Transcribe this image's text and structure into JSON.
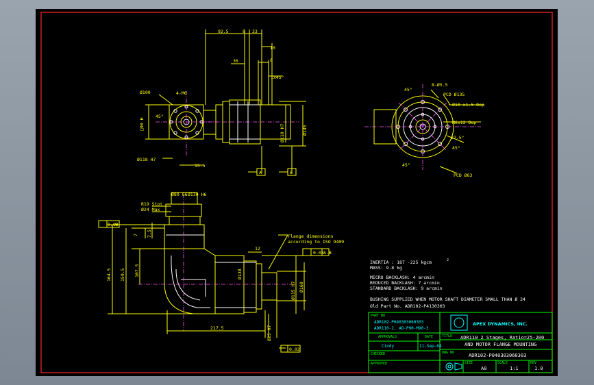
{
  "top_dims": {
    "d925": "92.5",
    "d8": "8",
    "d23": "23",
    "d10": "10",
    "d36": "36",
    "d6": "6",
    "d1x45": "1x45°",
    "d4m6": "4-M6",
    "d100": "Ø100",
    "d45": "45°",
    "d90": "□90 H",
    "d118": "Ø118 H7",
    "d155": "15.5",
    "dia110": "Ø110 H7",
    "d145": "Ø145",
    "A": "A",
    "B": "B"
  },
  "right_view": {
    "d55": "8-Ø5.5",
    "pcd135": "PCD Ø135",
    "m10": "Ø10 x1.5 Dep",
    "m6": "M6x12 Dep",
    "d45a": "45°",
    "d45b": "45°",
    "d225": "22.5°",
    "pcd63": "PCD Ø63",
    "d45c": "45°"
  },
  "side_dims": {
    "d80": "Ø80 G6",
    "d130": "Ø130 H6",
    "rt": "R19 Stot",
    "d24": "Ø24 Max",
    "tol1": "0.03",
    "tolA": "A",
    "d7": "7",
    "d75": "7.5",
    "d1645": "164.5",
    "d1595": "159.5",
    "d1075": "107.5",
    "d2175": "217.5",
    "d138": "Ø138",
    "d12": "12",
    "dia25": "Ø25 H7",
    "dia115": "Ø115 H7",
    "d160": "Ø160",
    "tol2": "0.03",
    "tolAB": "A-B",
    "tol3": "0.02",
    "flange": "Flange dimensions",
    "iso": "according to ISO 9409"
  },
  "notes": {
    "inertia": "INERTIA : 187 -225 kgcm",
    "sup": "2",
    "mass": "MASS: 9.8 kg",
    "micro": "MICRO BACKLASH: 4 arcmin",
    "reduced": "REDUCED BACKLASH: 7 arcmin",
    "standard": "STANDARD BACKLASH: 9 arcmin",
    "bushing": "BUSHING SUPPLIED WHEN MOTOR SHAFT DIAMETER SMALL THAN Ø 24",
    "old": "Old Part No. ADR102-P4130303"
  },
  "title_block": {
    "part_no_label": "PART NO",
    "part1": "ADR102-P040303060303",
    "part2": "ADR110-2, AD-P90-M90-3",
    "drawn_label": "APPROVALS",
    "date_label": "DATE",
    "drawn": "Cindy",
    "date": "11-Sep-08",
    "checked_label": "CHECKED",
    "approved_label": "APPROVED",
    "company": "APEX DYNAMICS, INC.",
    "title_label": "TITLE",
    "title1": "ADR110 2 Stages, Ratio=25-200",
    "title2": "AND MOTOR FLANGE MOUNTING",
    "dwg_label": "DWG NO",
    "dwg": "ADR102-P040303060303",
    "size_label": "SIZE",
    "size": "A0",
    "scale_label": "SCALE",
    "scale": "1:1",
    "rev_label": "REV",
    "rev": "1.0"
  }
}
